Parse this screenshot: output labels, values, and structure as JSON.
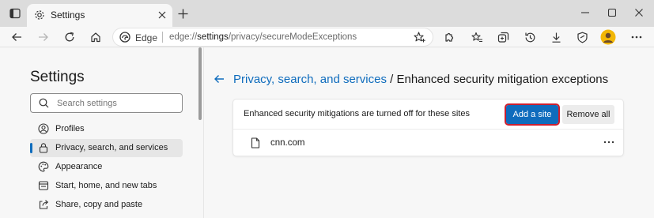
{
  "tab": {
    "title": "Settings"
  },
  "address": {
    "site_name": "Edge",
    "url_prefix": "edge://",
    "url_host": "settings",
    "url_path": "/privacy/secureModeExceptions"
  },
  "sidebar": {
    "title": "Settings",
    "search_placeholder": "Search settings",
    "items": [
      {
        "label": "Profiles",
        "icon": "profile-icon"
      },
      {
        "label": "Privacy, search, and services",
        "icon": "lock-icon",
        "active": true
      },
      {
        "label": "Appearance",
        "icon": "appearance-icon"
      },
      {
        "label": "Start, home, and new tabs",
        "icon": "start-home-icon"
      },
      {
        "label": "Share, copy and paste",
        "icon": "share-icon"
      }
    ]
  },
  "main": {
    "breadcrumb_link": "Privacy, search, and services",
    "breadcrumb_current": " / Enhanced security mitigation exceptions",
    "card": {
      "description": "Enhanced security mitigations are turned off for these sites",
      "add_button": "Add a site",
      "remove_button": "Remove all",
      "sites": [
        {
          "name": "cnn.com"
        }
      ]
    }
  },
  "colors": {
    "accent": "#0f6cbd",
    "highlight_outline": "#cc1f2f"
  }
}
